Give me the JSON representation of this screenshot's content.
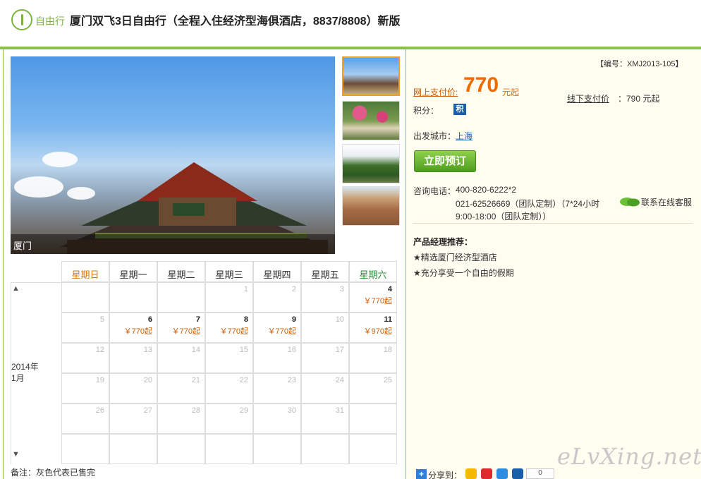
{
  "header": {
    "logo_label": "自由行",
    "title": "厦门双飞3日自由行（全程入住经济型海俱酒店，8837/8808）新版"
  },
  "gallery": {
    "caption": "厦门",
    "thumbnails": [
      "thumb-1",
      "thumb-2",
      "thumb-3",
      "thumb-4"
    ],
    "selected_thumbnail_index": 0
  },
  "calendar": {
    "weekdays": [
      "星期日",
      "星期一",
      "星期二",
      "星期三",
      "星期四",
      "星期五",
      "星期六"
    ],
    "month_label": "2014年\n1月",
    "up_arrow": "▲",
    "down_arrow": "▼",
    "weeks": [
      [
        {
          "d": ""
        },
        {
          "d": ""
        },
        {
          "d": ""
        },
        {
          "d": "1"
        },
        {
          "d": "2"
        },
        {
          "d": "3"
        },
        {
          "d": "4",
          "p": "￥770起",
          "av": true
        }
      ],
      [
        {
          "d": "5"
        },
        {
          "d": "6",
          "p": "￥770起",
          "av": true
        },
        {
          "d": "7",
          "p": "￥770起",
          "av": true
        },
        {
          "d": "8",
          "p": "￥770起",
          "av": true
        },
        {
          "d": "9",
          "p": "￥770起",
          "av": true
        },
        {
          "d": "10"
        },
        {
          "d": "11",
          "p": "￥970起",
          "av": true
        }
      ],
      [
        {
          "d": "12"
        },
        {
          "d": "13"
        },
        {
          "d": "14"
        },
        {
          "d": "15"
        },
        {
          "d": "16"
        },
        {
          "d": "17"
        },
        {
          "d": "18"
        }
      ],
      [
        {
          "d": "19"
        },
        {
          "d": "20"
        },
        {
          "d": "21"
        },
        {
          "d": "22"
        },
        {
          "d": "23"
        },
        {
          "d": "24"
        },
        {
          "d": "25"
        }
      ],
      [
        {
          "d": "26"
        },
        {
          "d": "27"
        },
        {
          "d": "28"
        },
        {
          "d": "29"
        },
        {
          "d": "30"
        },
        {
          "d": "31"
        },
        {
          "d": ""
        }
      ],
      [
        {
          "d": ""
        },
        {
          "d": ""
        },
        {
          "d": ""
        },
        {
          "d": ""
        },
        {
          "d": ""
        },
        {
          "d": ""
        },
        {
          "d": ""
        }
      ]
    ],
    "note": "备注：灰色代表已售完"
  },
  "product": {
    "code": "【编号：XMJ2013-105】",
    "online_price_label": "网上支付价:",
    "online_price": "770",
    "online_price_unit": "元起",
    "offline_price_label": "线下支付价",
    "offline_price": "：790 元起",
    "points_label": "积分：",
    "points_badge": "积",
    "departure_label": "出发城市：",
    "departure_city": "上海",
    "book_button": "立即预订",
    "phone_label": "咨询电话：",
    "phone_1": "400-820-6222*2",
    "phone_2": "021-62526669（团队定制）（7*24小时",
    "phone_3": "9:00-18:00（团队定制））",
    "chat_link": "联系在线客服",
    "recommend_title": "产品经理推荐：",
    "recommend_1": "★精选厦门经济型酒店",
    "recommend_2": "★充分享受一个自由的假期"
  },
  "share": {
    "label": "分享到：",
    "count": "0",
    "icons": [
      "qzone-icon",
      "weibo-icon",
      "qq-icon",
      "renren-icon"
    ]
  },
  "watermark": "eLvXing.net",
  "colors": {
    "accent_green": "#8bc34a",
    "price_orange": "#f06a00",
    "saturday_green": "#2e8b2e",
    "sunday_orange": "#d07a00"
  }
}
